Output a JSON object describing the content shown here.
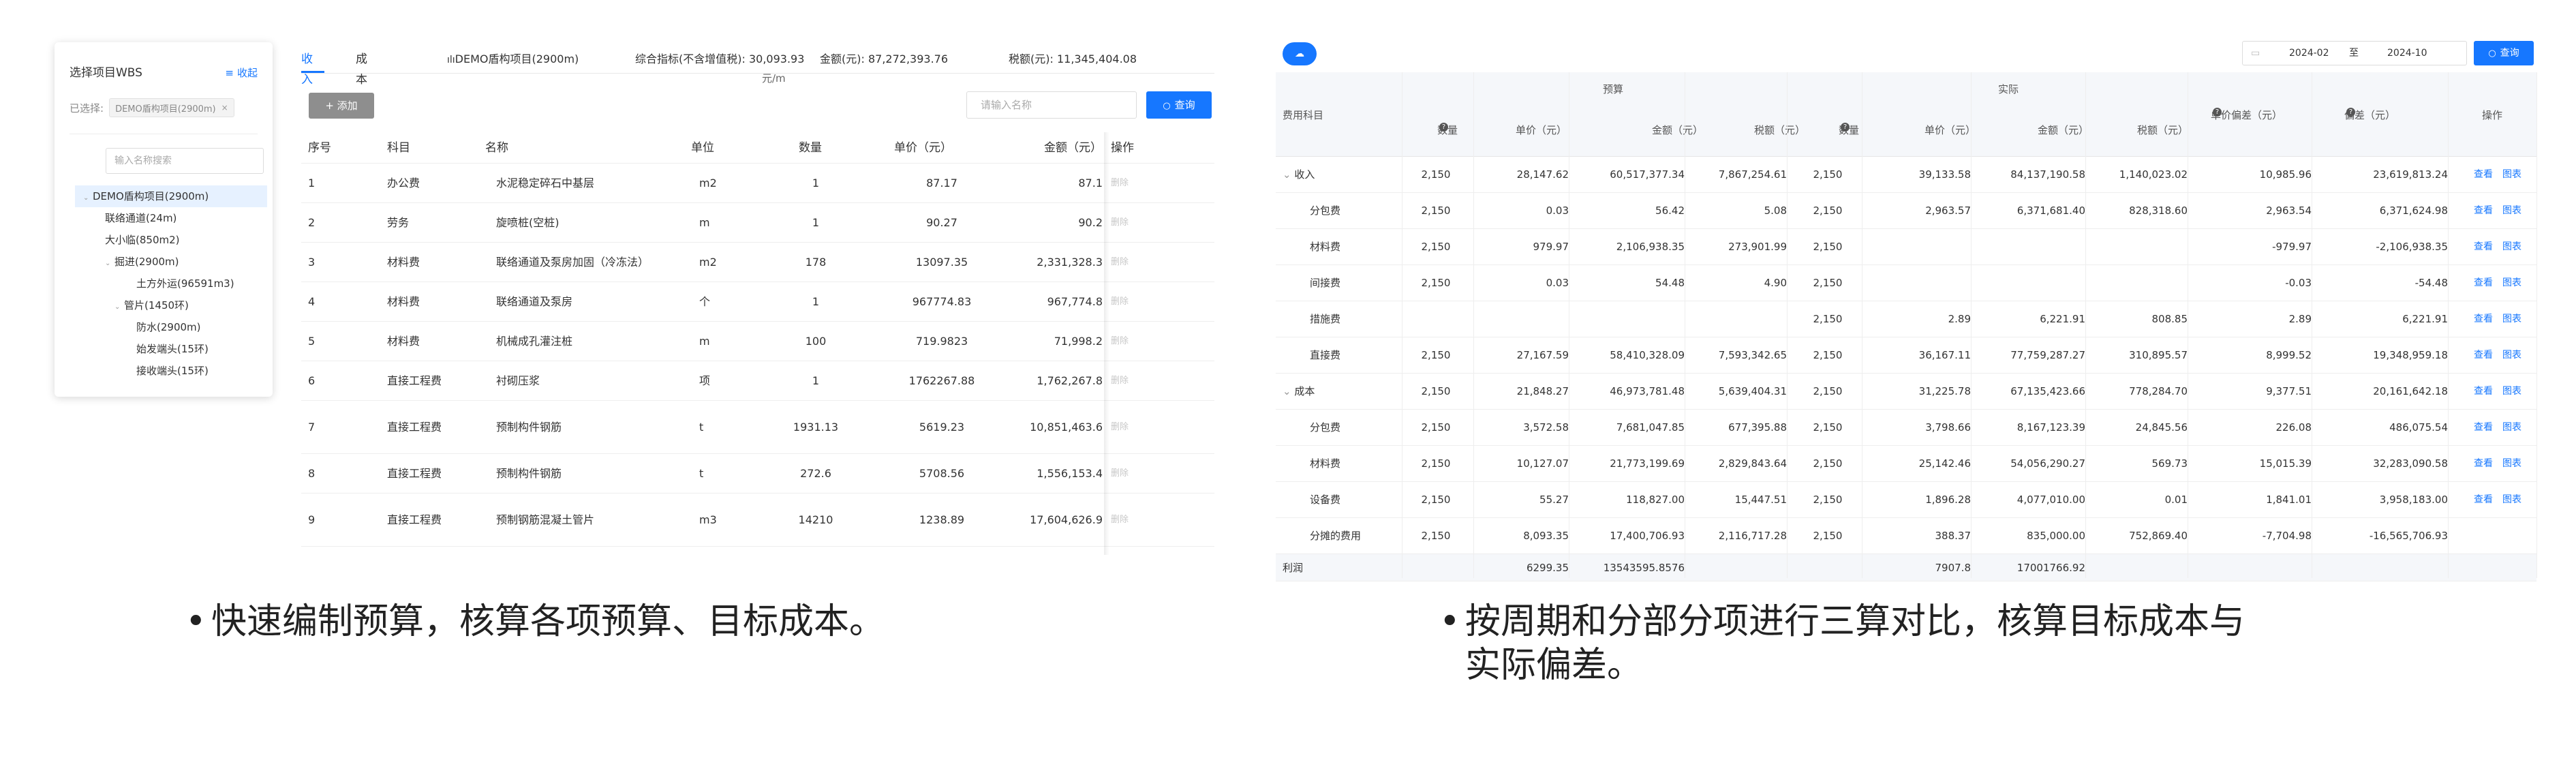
{
  "wbs": {
    "title": "选择项目WBS",
    "collapse_label": "收起",
    "selected_label": "已选择:",
    "selected_tag": "DEMO盾构项目(2900m)",
    "search_placeholder": "输入名称搜索",
    "tree": [
      {
        "label": "DEMO盾构项目(2900m)",
        "caret": "down",
        "selected": true
      },
      {
        "label": "联络通道(24m)"
      },
      {
        "label": "大小临(850m2)"
      },
      {
        "label": "掘进(2900m)",
        "caret": "down"
      },
      {
        "label": "土方外运(96591m3)"
      },
      {
        "label": "管片(1450环)",
        "caret": "down"
      },
      {
        "label": "防水(2900m)"
      },
      {
        "label": "始发端头(15环)"
      },
      {
        "label": "接收端头(15环)"
      }
    ]
  },
  "budget": {
    "tabs": [
      "收入",
      "成本"
    ],
    "active_tab": 0,
    "project_name": "DEMO盾构项目(2900m)",
    "index_label": "综合指标(不含增值税):",
    "index_value": "30,093.93",
    "index_unit": "元/m",
    "amount_label": "金额(元):",
    "amount_value": "87,272,393.76",
    "tax_label": "税额(元):",
    "tax_value": "11,345,404.08",
    "add_label": "添加",
    "search_placeholder": "请输入名称",
    "query_label": "查询",
    "columns": [
      "序号",
      "科目",
      "名称",
      "单位",
      "数量",
      "单价（元）",
      "金额（元）",
      "操作"
    ],
    "delete_label": "删除",
    "rows": [
      {
        "no": "1",
        "subject": "办公费",
        "name": "水泥稳定碎石中基层",
        "unit": "m2",
        "qty": "1",
        "price": "87.17",
        "amount": "87.1"
      },
      {
        "no": "2",
        "subject": "劳务",
        "name": "旋喷桩(空桩)",
        "unit": "m",
        "qty": "1",
        "price": "90.27",
        "amount": "90.2"
      },
      {
        "no": "3",
        "subject": "材料费",
        "name": "联络通道及泵房加固（冷冻法）",
        "unit": "m2",
        "qty": "178",
        "price": "13097.35",
        "amount": "2,331,328.3"
      },
      {
        "no": "4",
        "subject": "材料费",
        "name": "联络通道及泵房",
        "unit": "个",
        "qty": "1",
        "price": "967774.83",
        "amount": "967,774.8"
      },
      {
        "no": "5",
        "subject": "材料费",
        "name": "机械成孔灌注桩",
        "unit": "m",
        "qty": "100",
        "price": "719.9823",
        "amount": "71,998.2"
      },
      {
        "no": "6",
        "subject": "直接工程费",
        "name": "衬砌压浆",
        "unit": "项",
        "qty": "1",
        "price": "1762267.88",
        "amount": "1,762,267.8"
      },
      {
        "no": "7",
        "subject": "直接工程费",
        "name": "预制构件钢筋",
        "unit": "t",
        "qty": "1931.13",
        "price": "5619.23",
        "amount": "10,851,463.6"
      },
      {
        "no": "8",
        "subject": "直接工程费",
        "name": "预制构件钢筋",
        "unit": "t",
        "qty": "272.6",
        "price": "5708.56",
        "amount": "1,556,153.4"
      },
      {
        "no": "9",
        "subject": "直接工程费",
        "name": "预制钢筋混凝土管片",
        "unit": "m3",
        "qty": "14210",
        "price": "1238.89",
        "amount": "17,604,626.9"
      }
    ]
  },
  "compare": {
    "date_from": "2024-02",
    "date_sep": "至",
    "date_to": "2024-10",
    "query_label": "查询",
    "group_budget": "预算",
    "group_actual": "实际",
    "col_subject": "费用科目",
    "col_qty": "数量",
    "col_price": "单价（元）",
    "col_amount": "金额（元）",
    "col_tax": "税额（元）",
    "col_price_dev": "单价偏差（元）",
    "col_dev": "偏差（元）",
    "col_op": "操作",
    "view_label": "查看",
    "chart_label": "图表",
    "rows": [
      {
        "subject": "收入",
        "group": true,
        "b_qty": "2,150",
        "b_price": "28,147.62",
        "b_amount": "60,517,377.34",
        "b_tax": "7,867,254.61",
        "a_qty": "2,150",
        "a_price": "39,133.58",
        "a_amount": "84,137,190.58",
        "a_tax": "1,140,023.02",
        "price_dev": "10,985.96",
        "dev": "23,619,813.24",
        "ops": true
      },
      {
        "subject": "分包费",
        "b_qty": "2,150",
        "b_price": "0.03",
        "b_amount": "56.42",
        "b_tax": "5.08",
        "a_qty": "2,150",
        "a_price": "2,963.57",
        "a_amount": "6,371,681.40",
        "a_tax": "828,318.60",
        "price_dev": "2,963.54",
        "dev": "6,371,624.98",
        "ops": true
      },
      {
        "subject": "材料费",
        "b_qty": "2,150",
        "b_price": "979.97",
        "b_amount": "2,106,938.35",
        "b_tax": "273,901.99",
        "a_qty": "2,150",
        "a_price": "",
        "a_amount": "",
        "a_tax": "",
        "price_dev": "-979.97",
        "dev": "-2,106,938.35",
        "ops": true
      },
      {
        "subject": "间接费",
        "b_qty": "2,150",
        "b_price": "0.03",
        "b_amount": "54.48",
        "b_tax": "4.90",
        "a_qty": "2,150",
        "a_price": "",
        "a_amount": "",
        "a_tax": "",
        "price_dev": "-0.03",
        "dev": "-54.48",
        "ops": true
      },
      {
        "subject": "措施费",
        "b_qty": "",
        "b_price": "",
        "b_amount": "",
        "b_tax": "",
        "a_qty": "2,150",
        "a_price": "2.89",
        "a_amount": "6,221.91",
        "a_tax": "808.85",
        "price_dev": "2.89",
        "dev": "6,221.91",
        "ops": true
      },
      {
        "subject": "直接费",
        "b_qty": "2,150",
        "b_price": "27,167.59",
        "b_amount": "58,410,328.09",
        "b_tax": "7,593,342.65",
        "a_qty": "2,150",
        "a_price": "36,167.11",
        "a_amount": "77,759,287.27",
        "a_tax": "310,895.57",
        "price_dev": "8,999.52",
        "dev": "19,348,959.18",
        "ops": true
      },
      {
        "subject": "成本",
        "group": true,
        "b_qty": "2,150",
        "b_price": "21,848.27",
        "b_amount": "46,973,781.48",
        "b_tax": "5,639,404.31",
        "a_qty": "2,150",
        "a_price": "31,225.78",
        "a_amount": "67,135,423.66",
        "a_tax": "778,284.70",
        "price_dev": "9,377.51",
        "dev": "20,161,642.18",
        "ops": true
      },
      {
        "subject": "分包费",
        "b_qty": "2,150",
        "b_price": "3,572.58",
        "b_amount": "7,681,047.85",
        "b_tax": "677,395.88",
        "a_qty": "2,150",
        "a_price": "3,798.66",
        "a_amount": "8,167,123.39",
        "a_tax": "24,845.56",
        "price_dev": "226.08",
        "dev": "486,075.54",
        "ops": true
      },
      {
        "subject": "材料费",
        "b_qty": "2,150",
        "b_price": "10,127.07",
        "b_amount": "21,773,199.69",
        "b_tax": "2,829,843.64",
        "a_qty": "2,150",
        "a_price": "25,142.46",
        "a_amount": "54,056,290.27",
        "a_tax": "569.73",
        "price_dev": "15,015.39",
        "dev": "32,283,090.58",
        "ops": true
      },
      {
        "subject": "设备费",
        "b_qty": "2,150",
        "b_price": "55.27",
        "b_amount": "118,827.00",
        "b_tax": "15,447.51",
        "a_qty": "2,150",
        "a_price": "1,896.28",
        "a_amount": "4,077,010.00",
        "a_tax": "0.01",
        "price_dev": "1,841.01",
        "dev": "3,958,183.00",
        "ops": true
      },
      {
        "subject": "分摊的费用",
        "b_qty": "2,150",
        "b_price": "8,093.35",
        "b_amount": "17,400,706.93",
        "b_tax": "2,116,717.28",
        "a_qty": "2,150",
        "a_price": "388.37",
        "a_amount": "835,000.00",
        "a_tax": "752,869.40",
        "price_dev": "-7,704.98",
        "dev": "-16,565,706.93",
        "ops": false
      }
    ],
    "total": {
      "label": "利润",
      "b_price": "6299.35",
      "b_amount": "13543595.8576",
      "a_price": "7907.8",
      "a_amount": "17001766.92"
    }
  },
  "captions": {
    "left": "快速编制预算，核算各项预算、目标成本。",
    "right_line1": "按周期和分部分项进行三算对比，核算目标成本与",
    "right_line2": "实际偏差。"
  }
}
